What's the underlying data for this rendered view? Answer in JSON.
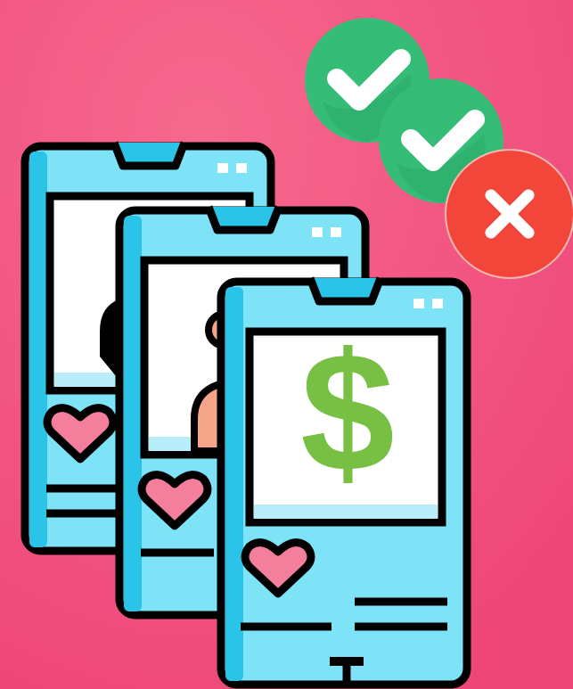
{
  "illustration": {
    "background_color": "#f04d7a",
    "phone_color": "#7ee3f7",
    "phone_accent": "#29c4e8",
    "outline_color": "#000000",
    "heart_color": "#f47f9c",
    "post_symbol": "$",
    "post_symbol_color": "#77c043",
    "badges": [
      {
        "icon": "check-icon",
        "color": "#35bd78"
      },
      {
        "icon": "check-icon",
        "color": "#35bd78"
      },
      {
        "icon": "x-icon",
        "color": "#f2463b"
      }
    ]
  }
}
